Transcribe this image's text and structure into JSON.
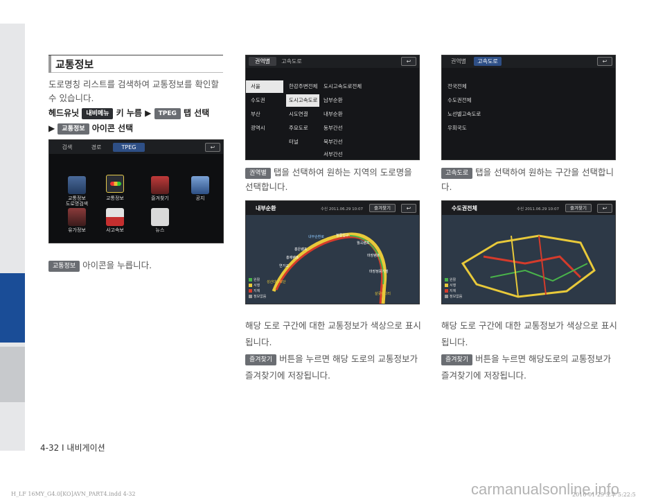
{
  "section": {
    "title": "교통정보"
  },
  "intro": "도로명칭 리스트를 검색하여 교통정보를 확인할 수 있습니다.",
  "steps": {
    "line1_prefix": "헤드유닛",
    "chip_navi": "내비메뉴",
    "line1_mid": "키 누름 ▶",
    "chip_tpeg": "TPEG",
    "line1_suffix": "탭 선택",
    "line2_prefix": "▶",
    "chip_traffic": "교통정보",
    "line2_suffix": "아이콘 선택"
  },
  "screen1": {
    "tabs": [
      "검색",
      "경로",
      "TPEG"
    ],
    "back": "↩",
    "icons": [
      {
        "label": "교통정보\n도로명검색"
      },
      {
        "label": "교통정보"
      },
      {
        "label": "즐겨찾기"
      },
      {
        "label": "공지"
      },
      {
        "label": "유가정보"
      },
      {
        "label": "사고속보"
      },
      {
        "label": "뉴스"
      }
    ]
  },
  "caption1": {
    "chip": "교통정보",
    "text": "아이콘을 누릅니다."
  },
  "screen2": {
    "tabs": [
      "권역별",
      "고속도로"
    ],
    "back": "↩",
    "col1": [
      "서울",
      "수도권",
      "부산",
      "광역시"
    ],
    "col2": [
      "한강주변전체",
      "도시고속도로",
      "시도연결",
      "주요도로",
      "터널"
    ],
    "col3": [
      "도시고속도로전체",
      "남부순환",
      "내부순환",
      "동부간선",
      "북부간선",
      "서부간선"
    ]
  },
  "caption2": {
    "chip": "권역별",
    "text": "탭을 선택하여 원하는 지역의 도로명을 선택합니다."
  },
  "screen3": {
    "tabs": [
      "권역별",
      "고속도로"
    ],
    "back": "↩",
    "items": [
      "전국전체",
      "수도권전체",
      "노선별고속도로",
      "우회국도"
    ]
  },
  "caption3": {
    "chip": "고속도로",
    "text": "탭을 선택하여 원하는 구간을 선택합니다."
  },
  "map1": {
    "title": "내부순환",
    "date": "수신 2011.06.29 10:07",
    "fav": "즐겨찾기",
    "back": "↩",
    "labels": [
      "내부순환로",
      "정릉입구",
      "월곡램프",
      "홍은램프",
      "홍제램프",
      "연가교",
      "마장램프",
      "마장정몽기점",
      "성산대교북단",
      "살곶이다리"
    ],
    "legend": [
      "원활",
      "서행",
      "지체",
      "정보없음"
    ]
  },
  "map2": {
    "title": "수도권전체",
    "date": "수신 2011.06.29 10:07",
    "fav": "즐겨찾기",
    "back": "↩",
    "legend": [
      "원활",
      "서행",
      "지체",
      "정보없음"
    ]
  },
  "caption4": {
    "text": "해당 도로 구간에 대한 교통정보가 색상으로 표시됩니다.",
    "chip": "즐겨찾기",
    "text2": "버튼을 누르면 해당 도로의 교통정보가 즐겨찾기에 저장됩니다."
  },
  "caption5": {
    "text": "해당 도로 구간에 대한 교통정보가 색상으로 표시됩니다.",
    "chip": "즐겨찾기",
    "text2": "버튼을 누르면 해당도로의 교통정보가 즐겨찾기에 저장됩니다."
  },
  "footer": {
    "page": "4-32 I 내비게이션"
  },
  "file": {
    "name": "H_LF 16MY_G4.0[KO]AVN_PART4.indd   4-32",
    "date": "2016-01-29   오후 5:22:5"
  },
  "watermark": "carmanualsonline.info"
}
